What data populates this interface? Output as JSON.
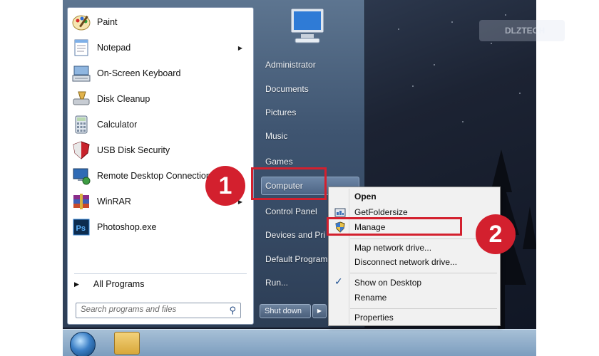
{
  "start_menu": {
    "programs": [
      {
        "label": "Paint",
        "icon": "paint-icon",
        "has_submenu": false
      },
      {
        "label": "Notepad",
        "icon": "notepad-icon",
        "has_submenu": true
      },
      {
        "label": "On-Screen Keyboard",
        "icon": "keyboard-icon",
        "has_submenu": false
      },
      {
        "label": "Disk Cleanup",
        "icon": "disk-cleanup-icon",
        "has_submenu": false
      },
      {
        "label": "Calculator",
        "icon": "calculator-icon",
        "has_submenu": false
      },
      {
        "label": "USB Disk Security",
        "icon": "shield-icon",
        "has_submenu": false
      },
      {
        "label": "Remote Desktop Connection",
        "icon": "remote-desktop-icon",
        "has_submenu": false
      },
      {
        "label": "WinRAR",
        "icon": "winrar-icon",
        "has_submenu": true
      },
      {
        "label": "Photoshop.exe",
        "icon": "photoshop-icon",
        "has_submenu": false
      }
    ],
    "all_programs": "All Programs",
    "search_placeholder": "Search programs and files",
    "right_items": [
      "Administrator",
      "Documents",
      "Pictures",
      "Music",
      "Games",
      "Computer",
      "Control Panel",
      "Devices and Pri",
      "Default Program",
      "Run..."
    ],
    "shutdown_label": "Shut down"
  },
  "context_menu": {
    "items": [
      {
        "label": "Open",
        "bold": true
      },
      {
        "label": "GetFoldersize",
        "icon": "folder-size-icon"
      },
      {
        "label": "Manage",
        "icon": "shield-uac-icon",
        "highlighted": true
      },
      {
        "label": "Map network drive..."
      },
      {
        "label": "Disconnect network drive..."
      },
      {
        "label": "Show on Desktop",
        "checked": true
      },
      {
        "label": "Rename"
      },
      {
        "label": "Properties"
      }
    ]
  },
  "annotations": {
    "step1": "1",
    "step2": "2",
    "color": "#d3202e"
  },
  "watermark": "DLZTECH"
}
